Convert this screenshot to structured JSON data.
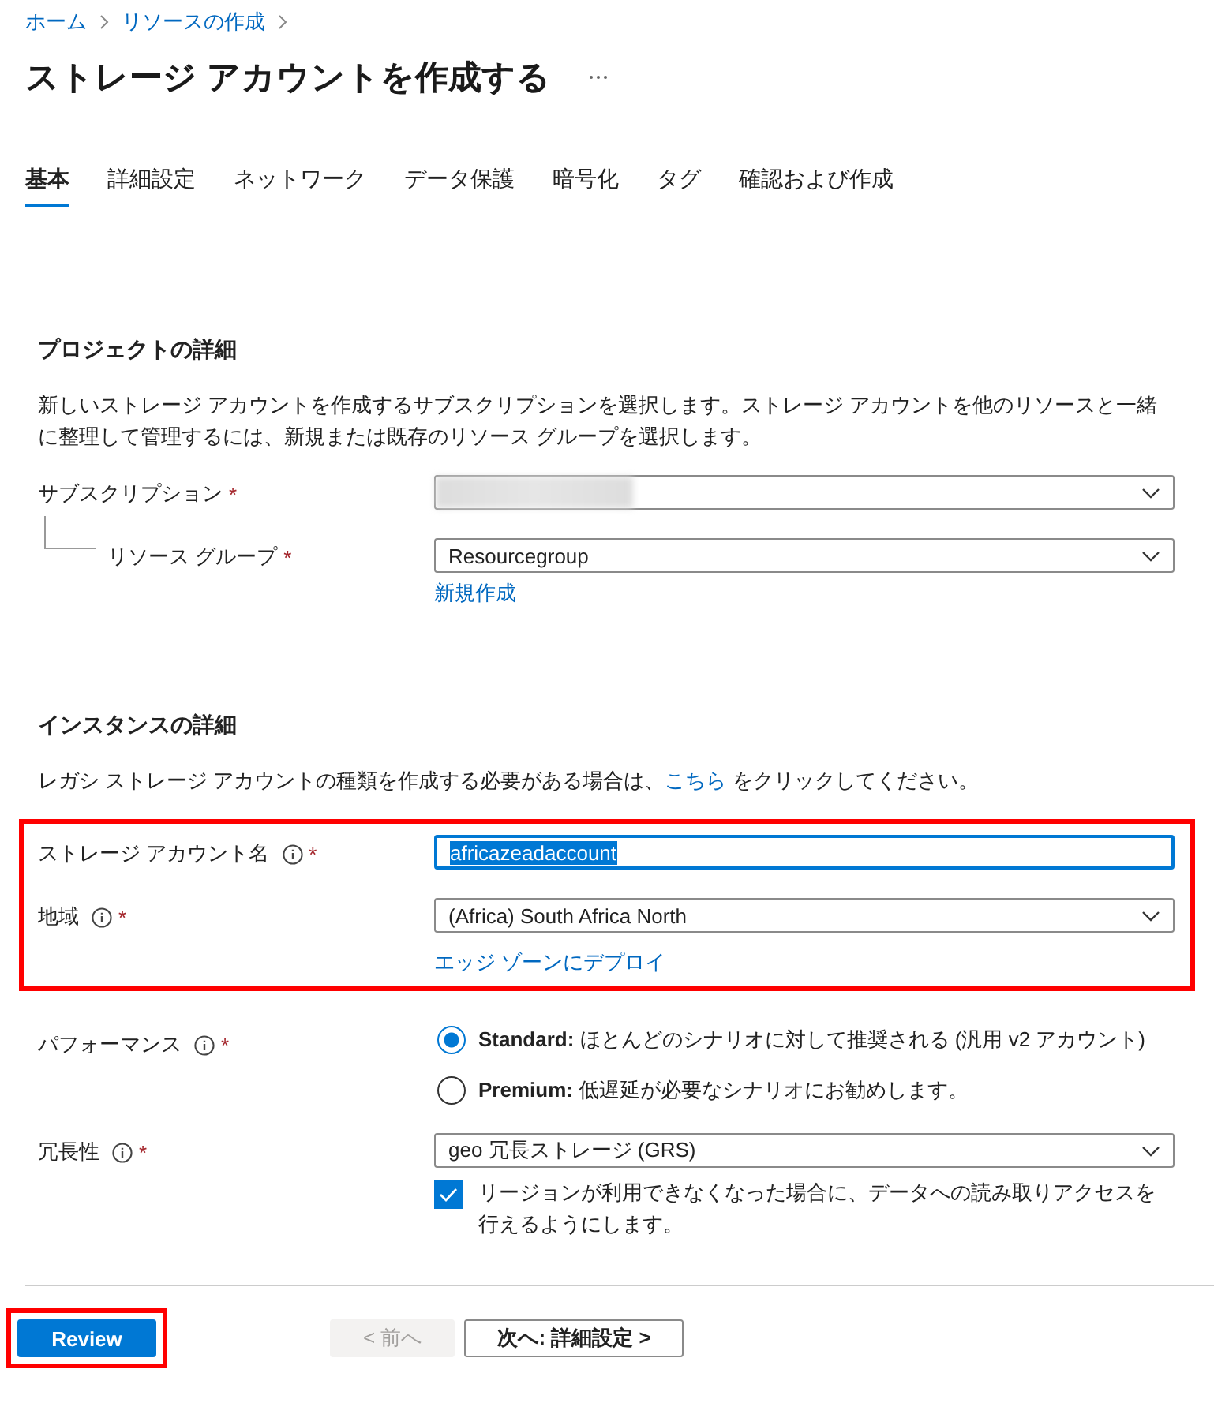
{
  "breadcrumb": [
    "ホーム",
    "リソースの作成"
  ],
  "title": "ストレージ アカウントを作成する",
  "tabs": [
    {
      "label": "基本",
      "selected": true
    },
    {
      "label": "詳細設定",
      "selected": false
    },
    {
      "label": "ネットワーク",
      "selected": false
    },
    {
      "label": "データ保護",
      "selected": false
    },
    {
      "label": "暗号化",
      "selected": false
    },
    {
      "label": "タグ",
      "selected": false
    },
    {
      "label": "確認および作成",
      "selected": false
    }
  ],
  "project": {
    "heading": "プロジェクトの詳細",
    "description": "新しいストレージ アカウントを作成するサブスクリプションを選択します。ストレージ アカウントを他のリソースと一緒に整理して管理するには、新規または既存のリソース グループを選択します。",
    "subscription": {
      "label": "サブスクリプション",
      "required_mark": "*"
    },
    "resource_group": {
      "label": "リソース グループ",
      "required_mark": "*",
      "value": "Resourcegroup",
      "link": "新規作成"
    }
  },
  "instance": {
    "heading": "インスタンスの詳細",
    "description_before": "レガシ ストレージ アカウントの種類を作成する必要がある場合は、",
    "description_link": "こちら",
    "description_after": "をクリックしてください。",
    "highlighted": true,
    "account_name": {
      "label": "ストレージ アカウント名",
      "required_mark": "*",
      "value": "africazeadaccount",
      "text_selected": true
    },
    "region": {
      "label": "地域",
      "required_mark": "*",
      "value": "(Africa) South Africa North",
      "link": "エッジ ゾーンにデプロイ"
    }
  },
  "performance": {
    "label": "パフォーマンス",
    "required_mark": "*",
    "options": [
      {
        "text": "**Standard:** ほとんどのシナリオに対して推奨される (汎用 v2 アカウント)",
        "selected": true
      },
      {
        "text": "**Premium:** 低遅延が必要なシナリオにお勧めします。",
        "selected": false
      }
    ]
  },
  "redundancy": {
    "label": "冗長性",
    "required_mark": "*",
    "value": "geo 冗長ストレージ (GRS)",
    "checkbox": {
      "label": "リージョンが利用できなくなった場合に、データへの読み取りアクセスを行えるようにします。",
      "checked": true
    }
  },
  "footer": [
    {
      "label": "Review",
      "kind": "primary",
      "highlighted": true
    },
    {
      "label": "< 前へ",
      "kind": "disabled",
      "highlighted": false
    },
    {
      "label": "次へ: 詳細設定 >",
      "kind": "secondary",
      "highlighted": false
    }
  ]
}
